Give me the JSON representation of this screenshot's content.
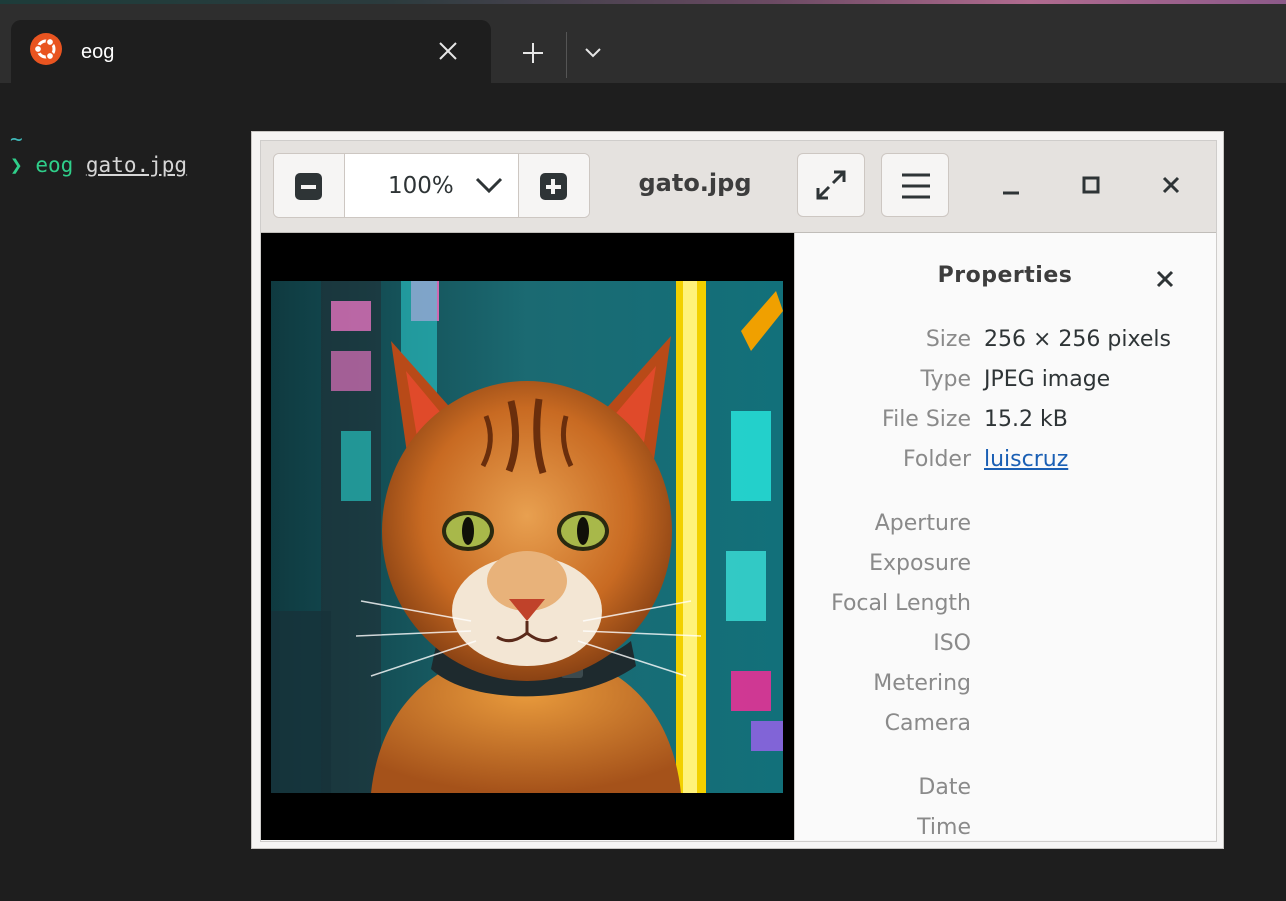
{
  "terminal": {
    "tab_title": "eog",
    "prompt_dir": "~",
    "prompt_symbol": "❯",
    "command": "eog",
    "argument": "gato.jpg"
  },
  "eog": {
    "zoom": "100%",
    "title": "gato.jpg",
    "properties": {
      "heading": "Properties",
      "rows": [
        {
          "key": "Size",
          "value": "256 × 256 pixels"
        },
        {
          "key": "Type",
          "value": "JPEG image"
        },
        {
          "key": "File Size",
          "value": "15.2 kB"
        },
        {
          "key": "Folder",
          "value": "luiscruz"
        },
        {
          "key": "Aperture",
          "value": ""
        },
        {
          "key": "Exposure",
          "value": ""
        },
        {
          "key": "Focal Length",
          "value": ""
        },
        {
          "key": "ISO",
          "value": ""
        },
        {
          "key": "Metering",
          "value": ""
        },
        {
          "key": "Camera",
          "value": ""
        },
        {
          "key": "Date",
          "value": ""
        },
        {
          "key": "Time",
          "value": ""
        }
      ]
    }
  },
  "icons": {
    "os_logo": "ubuntu-icon",
    "tab_close": "close-icon",
    "new_tab": "plus-icon",
    "dropdown": "chevron-down-icon",
    "zoom_out": "minus-icon",
    "zoom_in": "plus-icon",
    "fullscreen": "fullscreen-icon",
    "menu": "hamburger-icon",
    "minimize": "minimize-icon",
    "maximize": "maximize-icon",
    "close": "close-icon"
  },
  "colors": {
    "terminal_bg": "#1e1e1e",
    "prompt_green": "#2fcf8a",
    "tilde_cyan": "#3fb8b8",
    "link_blue": "#1a5fb4",
    "ubuntu_orange": "#e95420"
  }
}
